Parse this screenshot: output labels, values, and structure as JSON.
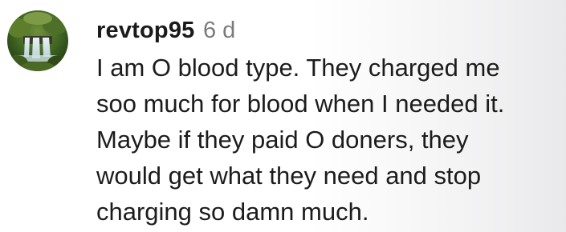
{
  "comment": {
    "avatar_icon": "waterfall-forest-avatar",
    "username": "revtop95",
    "timestamp": "6 d",
    "text_lines": [
      "I am O blood type. They charged me",
      "soo much for blood when I needed it.",
      "Maybe if they paid O doners, they",
      "would get what they need and stop",
      "charging so damn much."
    ]
  },
  "colors": {
    "username": "#1a1a1a",
    "timestamp": "#7b7b7b",
    "text": "#1c1c1c"
  }
}
